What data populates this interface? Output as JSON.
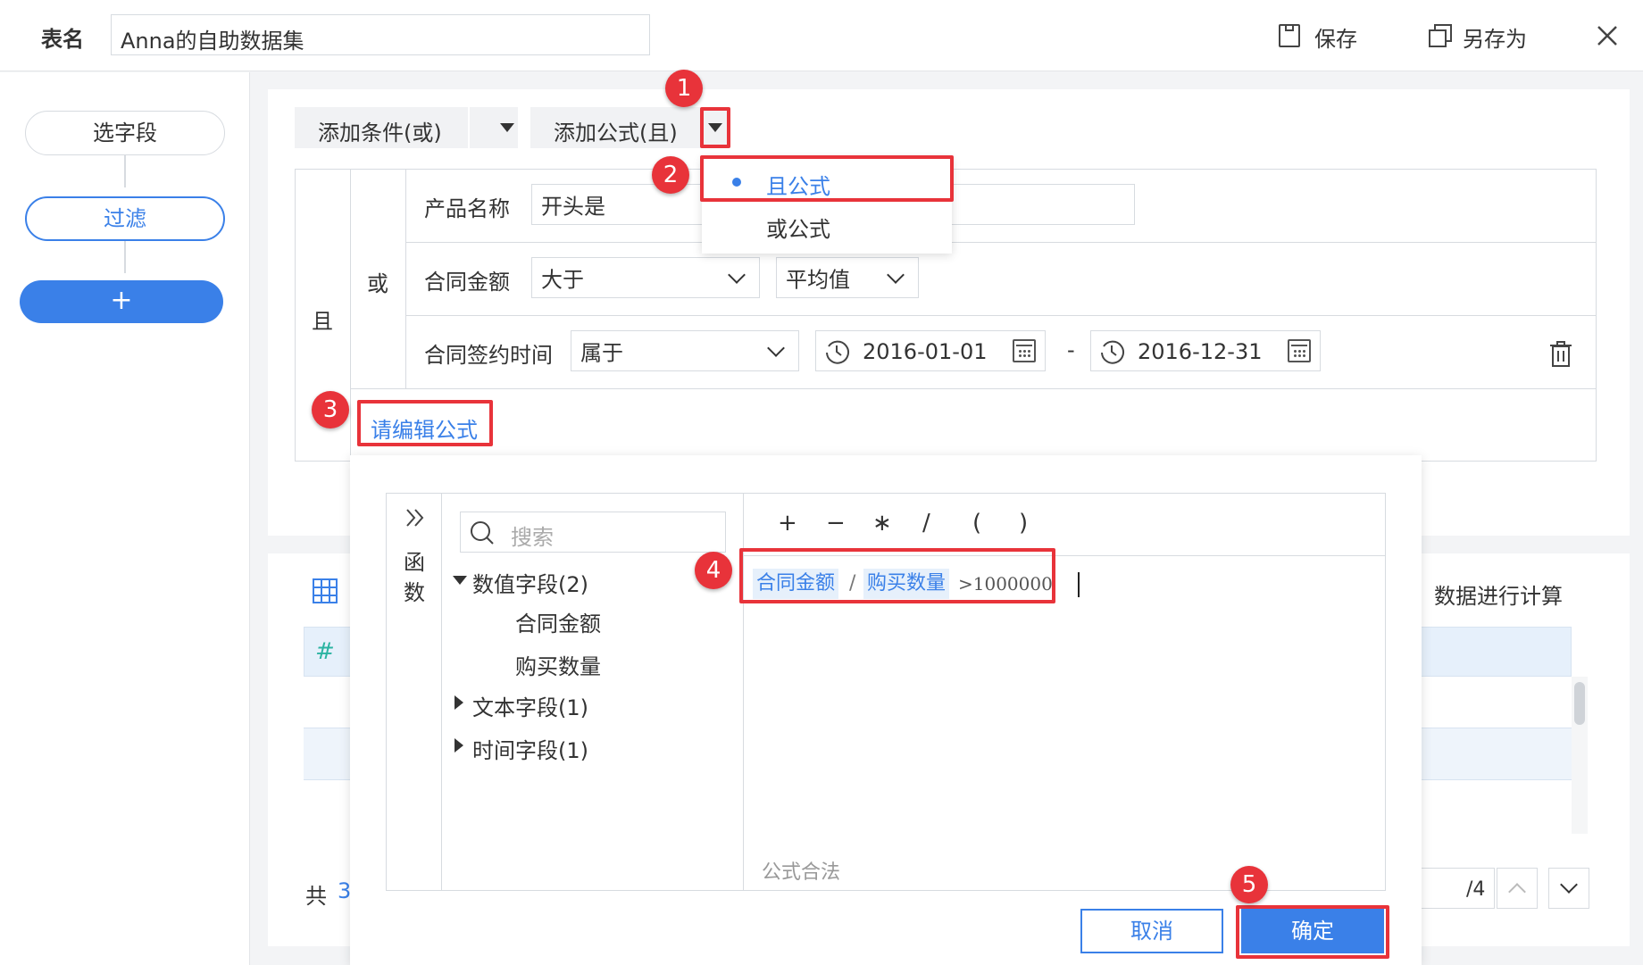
{
  "header": {
    "table_name_label": "表名",
    "table_name_value": "Anna的自助数据集",
    "save_label": "保存",
    "save_as_label": "另存为"
  },
  "steps": {
    "select_fields": "选字段",
    "filter": "过滤",
    "add": "+"
  },
  "filter": {
    "add_or_condition": "添加条件(或)",
    "add_and_formula": "添加公式(且)",
    "dropdown_items": [
      "且公式",
      "或公式"
    ],
    "and_label": "且",
    "or_label": "或",
    "conditions": [
      {
        "field": "产品名称",
        "operator": "开头是",
        "value": ""
      },
      {
        "field": "合同金额",
        "operator": "大于",
        "value": "平均值"
      },
      {
        "field": "合同签约时间",
        "operator": "属于",
        "start": "2016-01-01",
        "end": "2016-12-31",
        "separator": "-"
      }
    ],
    "edit_formula_link": "请编辑公式"
  },
  "lower": {
    "suffix_text": "数据进行计算",
    "hash": "#",
    "total_prefix": "共",
    "total_value": "3",
    "page_total": "/4"
  },
  "formula_editor": {
    "functions_label": "函数",
    "search_placeholder": "搜索",
    "tree": {
      "numeric_group": "数值字段(2)",
      "numeric_items": [
        "合同金额",
        "购买数量"
      ],
      "text_group": "文本字段(1)",
      "time_group": "时间字段(1)"
    },
    "operators": [
      "+",
      "−",
      "∗",
      "/",
      "(",
      ")"
    ],
    "formula": {
      "token1": "合同金额",
      "op": "/",
      "token2": "购买数量",
      "tail": ">1000000"
    },
    "status": "公式合法",
    "cancel_label": "取消",
    "confirm_label": "确定"
  },
  "badges": [
    "1",
    "2",
    "3",
    "4",
    "5"
  ],
  "colors": {
    "accent": "#3a80e8",
    "annotation_red": "#e8333a"
  }
}
